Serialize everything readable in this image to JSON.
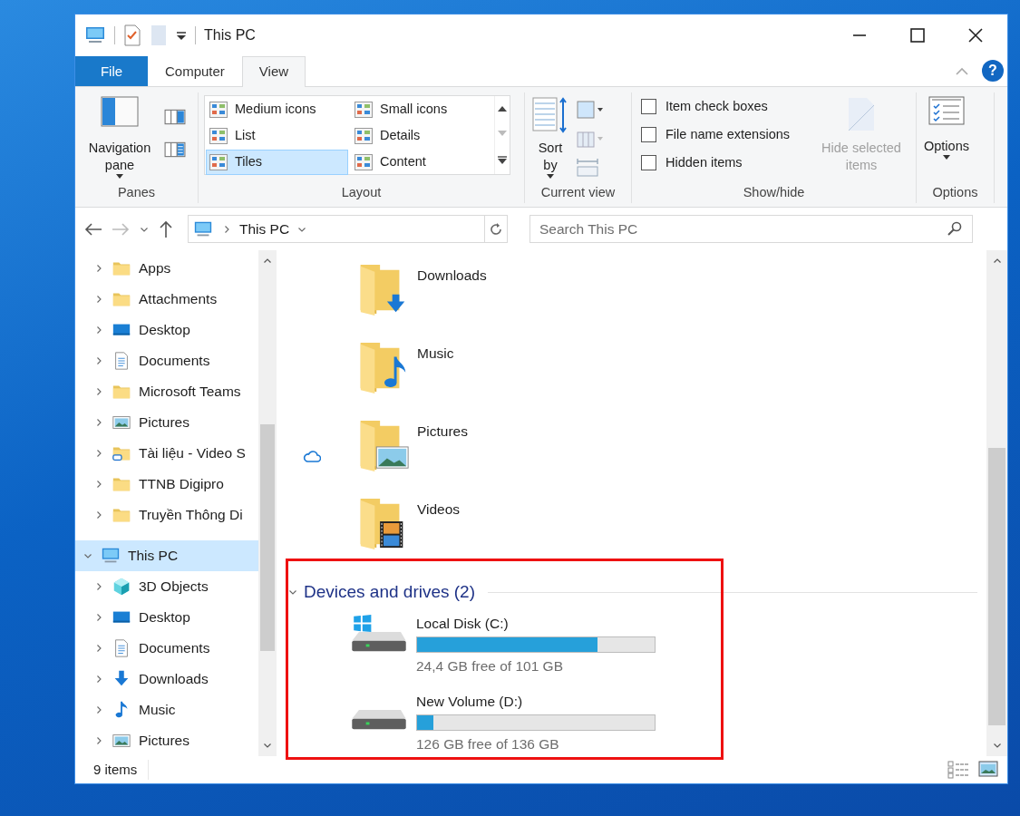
{
  "window": {
    "title": "This PC"
  },
  "ribbon_tabs": [
    {
      "label": "File",
      "kind": "file",
      "selected": false
    },
    {
      "label": "Computer",
      "kind": "tab",
      "selected": false
    },
    {
      "label": "View",
      "kind": "tab",
      "selected": true
    }
  ],
  "help": "?",
  "ribbon": {
    "panes": {
      "label": "Panes",
      "navigation_pane": "Navigation pane"
    },
    "layout": {
      "label": "Layout",
      "options": [
        {
          "label": "Medium icons",
          "selected": false
        },
        {
          "label": "Small icons",
          "selected": false
        },
        {
          "label": "List",
          "selected": false
        },
        {
          "label": "Details",
          "selected": false
        },
        {
          "label": "Tiles",
          "selected": true
        },
        {
          "label": "Content",
          "selected": false
        }
      ]
    },
    "current_view": {
      "label": "Current view",
      "sort_by": "Sort by"
    },
    "show_hide": {
      "label": "Show/hide",
      "checkboxes": [
        {
          "label": "Item check boxes",
          "checked": false
        },
        {
          "label": "File name extensions",
          "checked": false
        },
        {
          "label": "Hidden items",
          "checked": false
        }
      ],
      "hide_selected": {
        "label": "Hide selected items",
        "disabled": true
      }
    },
    "options": {
      "label": "Options",
      "button": "Options"
    }
  },
  "history": {
    "back_disabled": false,
    "forward_disabled": true
  },
  "address": "This PC",
  "search": {
    "placeholder": "Search This PC"
  },
  "nav_pane": {
    "partial_group": [
      {
        "label": "Apps",
        "kind": "folder",
        "expanded": false,
        "selected": false
      },
      {
        "label": "Attachments",
        "kind": "folder",
        "expanded": false,
        "selected": false
      },
      {
        "label": "Desktop",
        "kind": "desktop",
        "expanded": false,
        "selected": false
      },
      {
        "label": "Documents",
        "kind": "document",
        "expanded": false,
        "selected": false
      },
      {
        "label": "Microsoft Teams",
        "kind": "folder",
        "expanded": false,
        "selected": false
      },
      {
        "label": "Pictures",
        "kind": "picture",
        "expanded": false,
        "selected": false
      },
      {
        "label": "Tài liệu - Video S",
        "kind": "shared",
        "expanded": false,
        "selected": false
      },
      {
        "label": "TTNB Digipro",
        "kind": "folder",
        "expanded": false,
        "selected": false
      },
      {
        "label": "Truyền Thông Di",
        "kind": "folder",
        "expanded": false,
        "selected": false
      }
    ],
    "items": [
      {
        "label": "This PC",
        "kind": "pc",
        "expanded": true,
        "selected": true,
        "children": [
          {
            "label": "3D Objects",
            "kind": "cube",
            "expanded": false,
            "selected": false
          },
          {
            "label": "Desktop",
            "kind": "desktop",
            "expanded": false,
            "selected": false
          },
          {
            "label": "Documents",
            "kind": "document",
            "expanded": false,
            "selected": false
          },
          {
            "label": "Downloads",
            "kind": "download",
            "expanded": false,
            "selected": false
          },
          {
            "label": "Music",
            "kind": "music",
            "expanded": false,
            "selected": false
          },
          {
            "label": "Pictures",
            "kind": "picture",
            "expanded": false,
            "selected": false
          }
        ]
      }
    ]
  },
  "folders": [
    {
      "label": "Downloads",
      "kind": "downloads",
      "cloud": false
    },
    {
      "label": "Music",
      "kind": "music",
      "cloud": false
    },
    {
      "label": "Pictures",
      "kind": "pictures",
      "cloud": true
    },
    {
      "label": "Videos",
      "kind": "videos",
      "cloud": false
    }
  ],
  "devices": {
    "heading": "Devices and drives (2)",
    "expanded": true,
    "drives": [
      {
        "name": "Local Disk (C:)",
        "kind": "system",
        "level": 0.76,
        "free": "24,4 GB free of 101 GB"
      },
      {
        "name": "New Volume (D:)",
        "kind": "data",
        "level": 0.07,
        "free": "126 GB free of 136 GB"
      }
    ]
  },
  "status_bar": {
    "count": "9 items"
  }
}
